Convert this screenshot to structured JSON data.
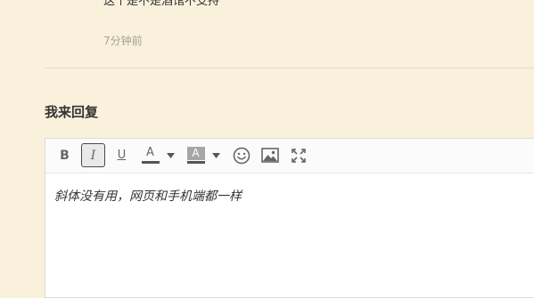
{
  "comment": {
    "text": "这个是不是酒馆不支持",
    "time": "7分钟前"
  },
  "reply": {
    "title": "我来回复",
    "toolbar": {
      "bold": "B",
      "italic": "I",
      "underline": "U",
      "font_color": "A",
      "background_color": "A",
      "font_color_bar": "#555555",
      "background_color_fill": "#a6a6a6",
      "icons": [
        "bold-icon",
        "italic-icon",
        "underline-icon",
        "font-color-icon",
        "dropdown-icon",
        "background-color-icon",
        "dropdown-icon",
        "emoji-icon",
        "image-icon",
        "fullscreen-icon"
      ]
    },
    "editor_text": "斜体没有用，网页和手机端都一样"
  },
  "colors": {
    "page_background": "#faf1dd",
    "editor_background": "#ffffff",
    "toolbar_background": "#fbfbfb"
  }
}
